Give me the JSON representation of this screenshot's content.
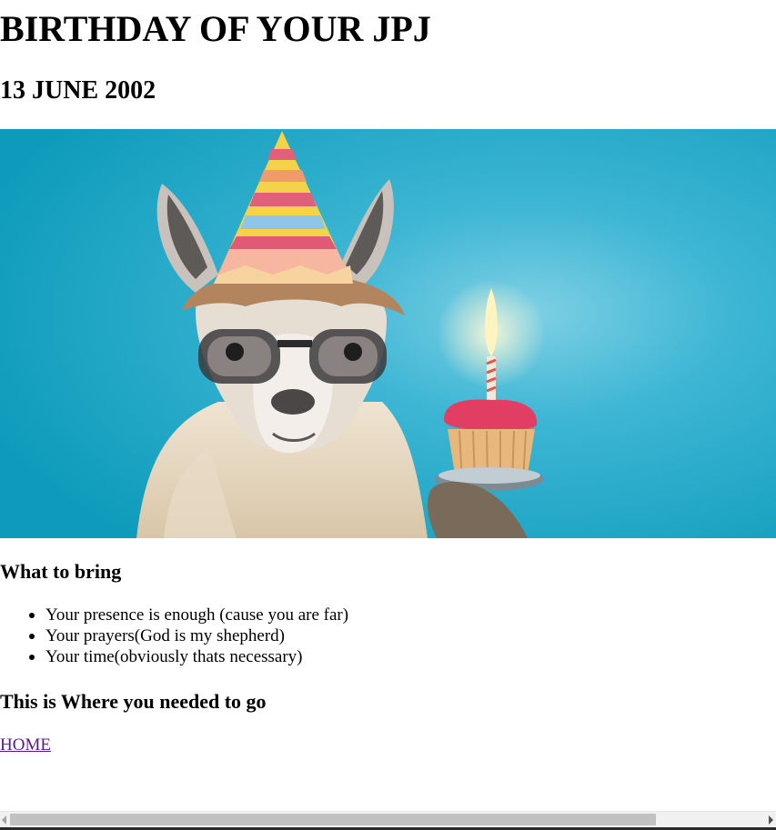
{
  "header": {
    "title": "BIRTHDAY OF YOUR JPJ",
    "date": "13 JUNE 2002"
  },
  "hero_image": {
    "icon": "birthday-llama-image",
    "background_color": "#2aaec9"
  },
  "what_to_bring": {
    "heading": "What to bring",
    "items": [
      "Your presence is enough (cause you are far)",
      "Your prayers(God is my shepherd)",
      "Your time(obviously thats necessary)"
    ]
  },
  "where": {
    "heading": "This is Where you needed to go",
    "link_label": "HOME"
  },
  "colors": {
    "link_visited": "#551a8b",
    "scrollbar_thumb": "#c1c1c1"
  }
}
